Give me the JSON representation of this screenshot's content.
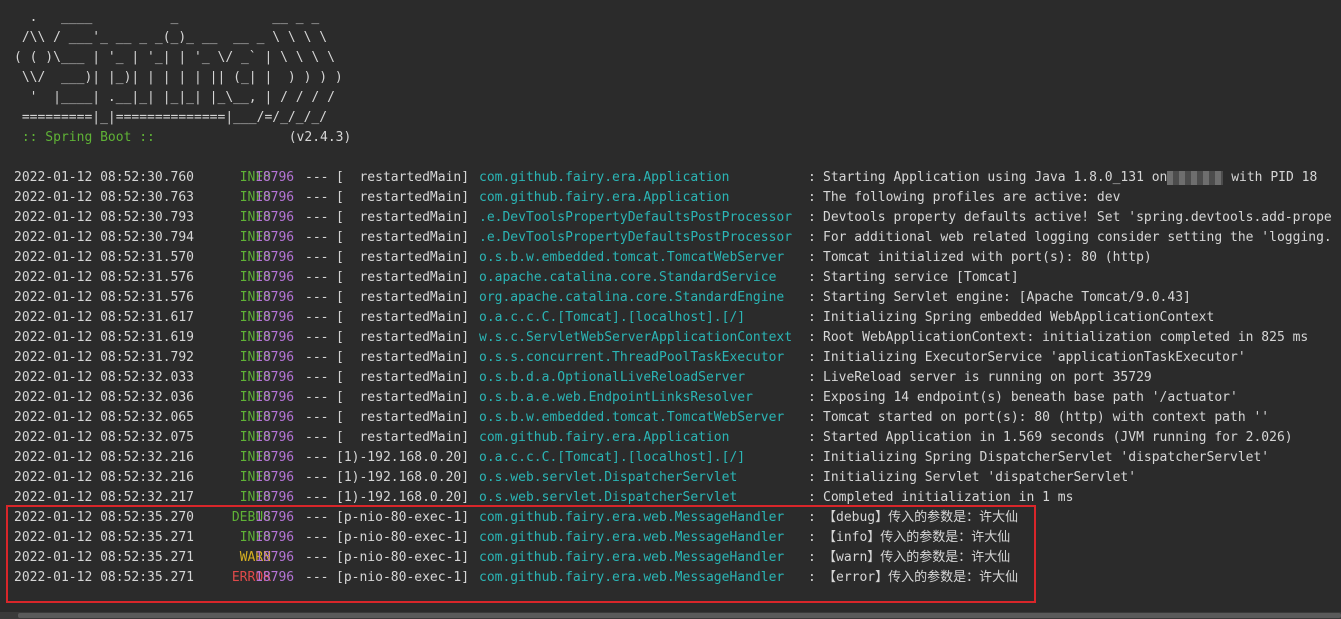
{
  "banner": {
    "ascii": "  .   ____          _            __ _ _\n /\\\\ / ___'_ __ _ _(_)_ __  __ _ \\ \\ \\ \\\n( ( )\\___ | '_ | '_| | '_ \\/ _` | \\ \\ \\ \\\n \\\\/  ___)| |_)| | | | | || (_| |  ) ) ) )\n  '  |____| .__|_| |_|_| |_\\__, | / / / /\n =========|_|==============|___/=/_/_/_/",
    "boot_label": " :: Spring Boot :: ",
    "boot_version": "(v2.4.3)"
  },
  "colors": {
    "background": "#2b2b2b",
    "info": "#5fb236",
    "warn": "#d7b022",
    "error": "#e04a4a",
    "pid": "#b574d6",
    "logger": "#2bb5b5",
    "highlight": "#d9262a"
  },
  "log_lines": [
    {
      "ts": "2022-01-12 08:52:30.760",
      "level": "INFO",
      "pid": "18796",
      "sep": "---",
      "thread": "[  restartedMain]",
      "logger": "com.github.fairy.era.Application",
      "msg": "Starting Application using Java 1.8.0_131 on",
      "msg_tail": " with PID 18",
      "masked": true
    },
    {
      "ts": "2022-01-12 08:52:30.763",
      "level": "INFO",
      "pid": "18796",
      "sep": "---",
      "thread": "[  restartedMain]",
      "logger": "com.github.fairy.era.Application",
      "msg": "The following profiles are active: dev"
    },
    {
      "ts": "2022-01-12 08:52:30.793",
      "level": "INFO",
      "pid": "18796",
      "sep": "---",
      "thread": "[  restartedMain]",
      "logger": ".e.DevToolsPropertyDefaultsPostProcessor",
      "msg": "Devtools property defaults active! Set 'spring.devtools.add-prope"
    },
    {
      "ts": "2022-01-12 08:52:30.794",
      "level": "INFO",
      "pid": "18796",
      "sep": "---",
      "thread": "[  restartedMain]",
      "logger": ".e.DevToolsPropertyDefaultsPostProcessor",
      "msg": "For additional web related logging consider setting the 'logging."
    },
    {
      "ts": "2022-01-12 08:52:31.570",
      "level": "INFO",
      "pid": "18796",
      "sep": "---",
      "thread": "[  restartedMain]",
      "logger": "o.s.b.w.embedded.tomcat.TomcatWebServer",
      "msg": "Tomcat initialized with port(s): 80 (http)"
    },
    {
      "ts": "2022-01-12 08:52:31.576",
      "level": "INFO",
      "pid": "18796",
      "sep": "---",
      "thread": "[  restartedMain]",
      "logger": "o.apache.catalina.core.StandardService",
      "msg": "Starting service [Tomcat]"
    },
    {
      "ts": "2022-01-12 08:52:31.576",
      "level": "INFO",
      "pid": "18796",
      "sep": "---",
      "thread": "[  restartedMain]",
      "logger": "org.apache.catalina.core.StandardEngine",
      "msg": "Starting Servlet engine: [Apache Tomcat/9.0.43]"
    },
    {
      "ts": "2022-01-12 08:52:31.617",
      "level": "INFO",
      "pid": "18796",
      "sep": "---",
      "thread": "[  restartedMain]",
      "logger": "o.a.c.c.C.[Tomcat].[localhost].[/]",
      "msg": "Initializing Spring embedded WebApplicationContext"
    },
    {
      "ts": "2022-01-12 08:52:31.619",
      "level": "INFO",
      "pid": "18796",
      "sep": "---",
      "thread": "[  restartedMain]",
      "logger": "w.s.c.ServletWebServerApplicationContext",
      "msg": "Root WebApplicationContext: initialization completed in 825 ms"
    },
    {
      "ts": "2022-01-12 08:52:31.792",
      "level": "INFO",
      "pid": "18796",
      "sep": "---",
      "thread": "[  restartedMain]",
      "logger": "o.s.s.concurrent.ThreadPoolTaskExecutor",
      "msg": "Initializing ExecutorService 'applicationTaskExecutor'"
    },
    {
      "ts": "2022-01-12 08:52:32.033",
      "level": "INFO",
      "pid": "18796",
      "sep": "---",
      "thread": "[  restartedMain]",
      "logger": "o.s.b.d.a.OptionalLiveReloadServer",
      "msg": "LiveReload server is running on port 35729"
    },
    {
      "ts": "2022-01-12 08:52:32.036",
      "level": "INFO",
      "pid": "18796",
      "sep": "---",
      "thread": "[  restartedMain]",
      "logger": "o.s.b.a.e.web.EndpointLinksResolver",
      "msg": "Exposing 14 endpoint(s) beneath base path '/actuator'"
    },
    {
      "ts": "2022-01-12 08:52:32.065",
      "level": "INFO",
      "pid": "18796",
      "sep": "---",
      "thread": "[  restartedMain]",
      "logger": "o.s.b.w.embedded.tomcat.TomcatWebServer",
      "msg": "Tomcat started on port(s): 80 (http) with context path ''"
    },
    {
      "ts": "2022-01-12 08:52:32.075",
      "level": "INFO",
      "pid": "18796",
      "sep": "---",
      "thread": "[  restartedMain]",
      "logger": "com.github.fairy.era.Application",
      "msg": "Started Application in 1.569 seconds (JVM running for 2.026)"
    },
    {
      "ts": "2022-01-12 08:52:32.216",
      "level": "INFO",
      "pid": "18796",
      "sep": "---",
      "thread": "[1)-192.168.0.20]",
      "logger": "o.a.c.c.C.[Tomcat].[localhost].[/]",
      "msg": "Initializing Spring DispatcherServlet 'dispatcherServlet'"
    },
    {
      "ts": "2022-01-12 08:52:32.216",
      "level": "INFO",
      "pid": "18796",
      "sep": "---",
      "thread": "[1)-192.168.0.20]",
      "logger": "o.s.web.servlet.DispatcherServlet",
      "msg": "Initializing Servlet 'dispatcherServlet'"
    },
    {
      "ts": "2022-01-12 08:52:32.217",
      "level": "INFO",
      "pid": "18796",
      "sep": "---",
      "thread": "[1)-192.168.0.20]",
      "logger": "o.s.web.servlet.DispatcherServlet",
      "msg": "Completed initialization in 1 ms"
    },
    {
      "ts": "2022-01-12 08:52:35.270",
      "level": "DEBUG",
      "pid": "18796",
      "sep": "---",
      "thread": "[p-nio-80-exec-1]",
      "logger": "com.github.fairy.era.web.MessageHandler",
      "msg": "【debug】传入的参数是：许大仙"
    },
    {
      "ts": "2022-01-12 08:52:35.271",
      "level": "INFO",
      "pid": "18796",
      "sep": "---",
      "thread": "[p-nio-80-exec-1]",
      "logger": "com.github.fairy.era.web.MessageHandler",
      "msg": "【info】传入的参数是：许大仙"
    },
    {
      "ts": "2022-01-12 08:52:35.271",
      "level": "WARN",
      "pid": "18796",
      "sep": "---",
      "thread": "[p-nio-80-exec-1]",
      "logger": "com.github.fairy.era.web.MessageHandler",
      "msg": "【warn】传入的参数是：许大仙"
    },
    {
      "ts": "2022-01-12 08:52:35.271",
      "level": "ERROR",
      "pid": "18796",
      "sep": "---",
      "thread": "[p-nio-80-exec-1]",
      "logger": "com.github.fairy.era.web.MessageHandler",
      "msg": "【error】传入的参数是：许大仙"
    }
  ]
}
